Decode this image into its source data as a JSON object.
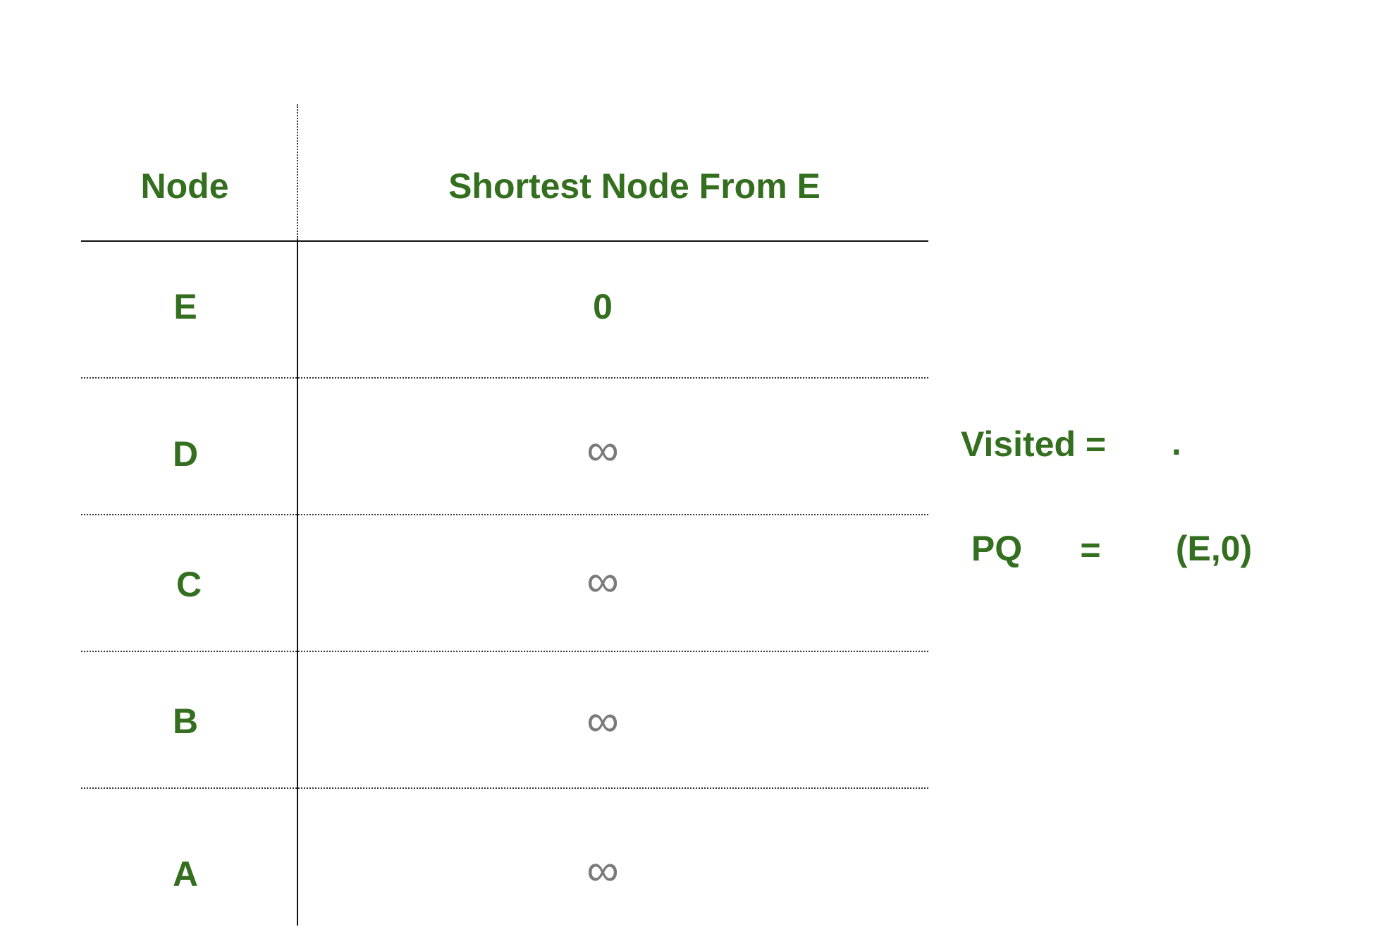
{
  "colors": {
    "text_green": "#336f1f",
    "infinity_gray": "#7a7a7a",
    "line": "#111111"
  },
  "table": {
    "headers": {
      "node": "Node",
      "distance": "Shortest Node From E"
    },
    "rows": [
      {
        "node": "E",
        "distance": "0"
      },
      {
        "node": "D",
        "distance": "∞"
      },
      {
        "node": "C",
        "distance": "∞"
      },
      {
        "node": "B",
        "distance": "∞"
      },
      {
        "node": "A",
        "distance": "∞"
      }
    ]
  },
  "side_panel": {
    "visited_label": "Visited =",
    "visited_value": ".",
    "pq_label": "PQ",
    "pq_equals": "=",
    "pq_value": "(E,0)"
  }
}
